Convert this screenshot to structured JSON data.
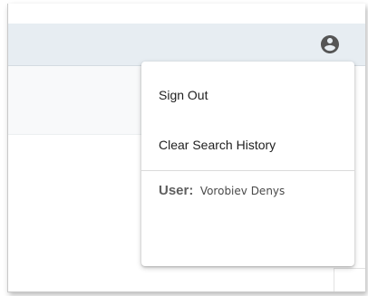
{
  "header": {
    "account_icon": "account-circle-icon"
  },
  "menu": {
    "items": [
      {
        "label": "Sign Out"
      },
      {
        "label": "Clear Search History"
      }
    ],
    "user": {
      "label": "User:",
      "name": "Vorobiev Denys"
    }
  },
  "colors": {
    "topbar": "#e7edf2",
    "icon": "#555555",
    "text": "#212121"
  }
}
